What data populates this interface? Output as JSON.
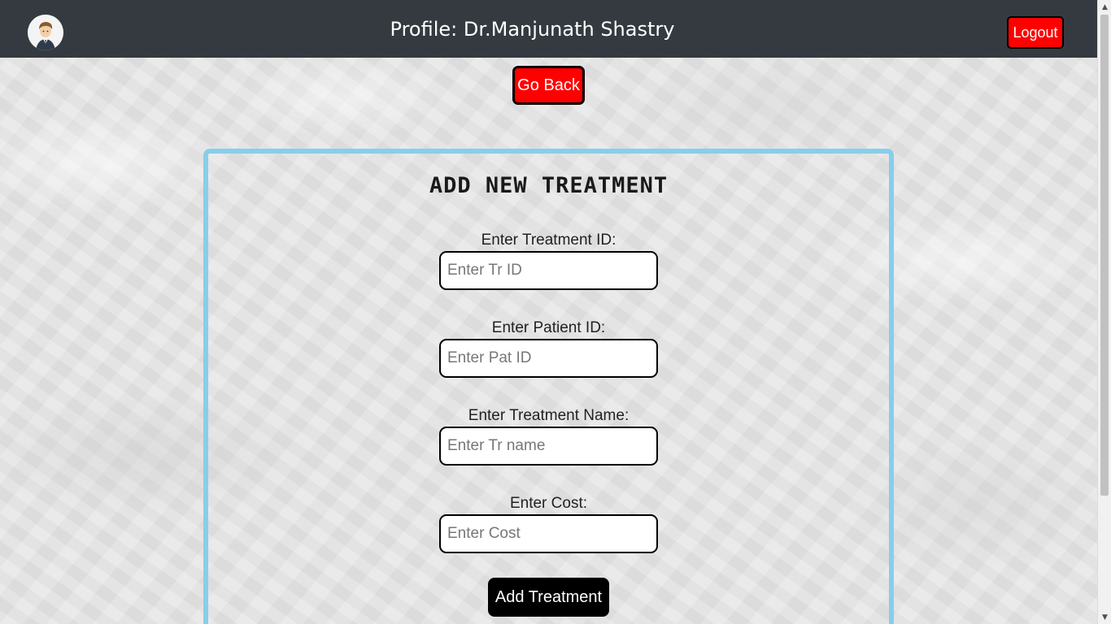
{
  "navbar": {
    "title": "Profile: Dr.Manjunath Shastry",
    "logout_label": "Logout",
    "avatar_icon": "doctor-avatar-icon"
  },
  "actions": {
    "go_back_label": "Go Back"
  },
  "form": {
    "title": "ADD NEW TREATMENT",
    "fields": [
      {
        "label": "Enter Treatment ID:",
        "placeholder": "Enter Tr ID",
        "value": ""
      },
      {
        "label": "Enter Patient ID:",
        "placeholder": "Enter Pat ID",
        "value": ""
      },
      {
        "label": "Enter Treatment Name:",
        "placeholder": "Enter Tr name",
        "value": ""
      },
      {
        "label": "Enter Cost:",
        "placeholder": "Enter Cost",
        "value": ""
      }
    ],
    "submit_label": "Add Treatment"
  },
  "colors": {
    "navbar_bg": "#343a40",
    "danger": "#ff0000",
    "card_border": "#87ceeb",
    "submit_bg": "#000000"
  }
}
